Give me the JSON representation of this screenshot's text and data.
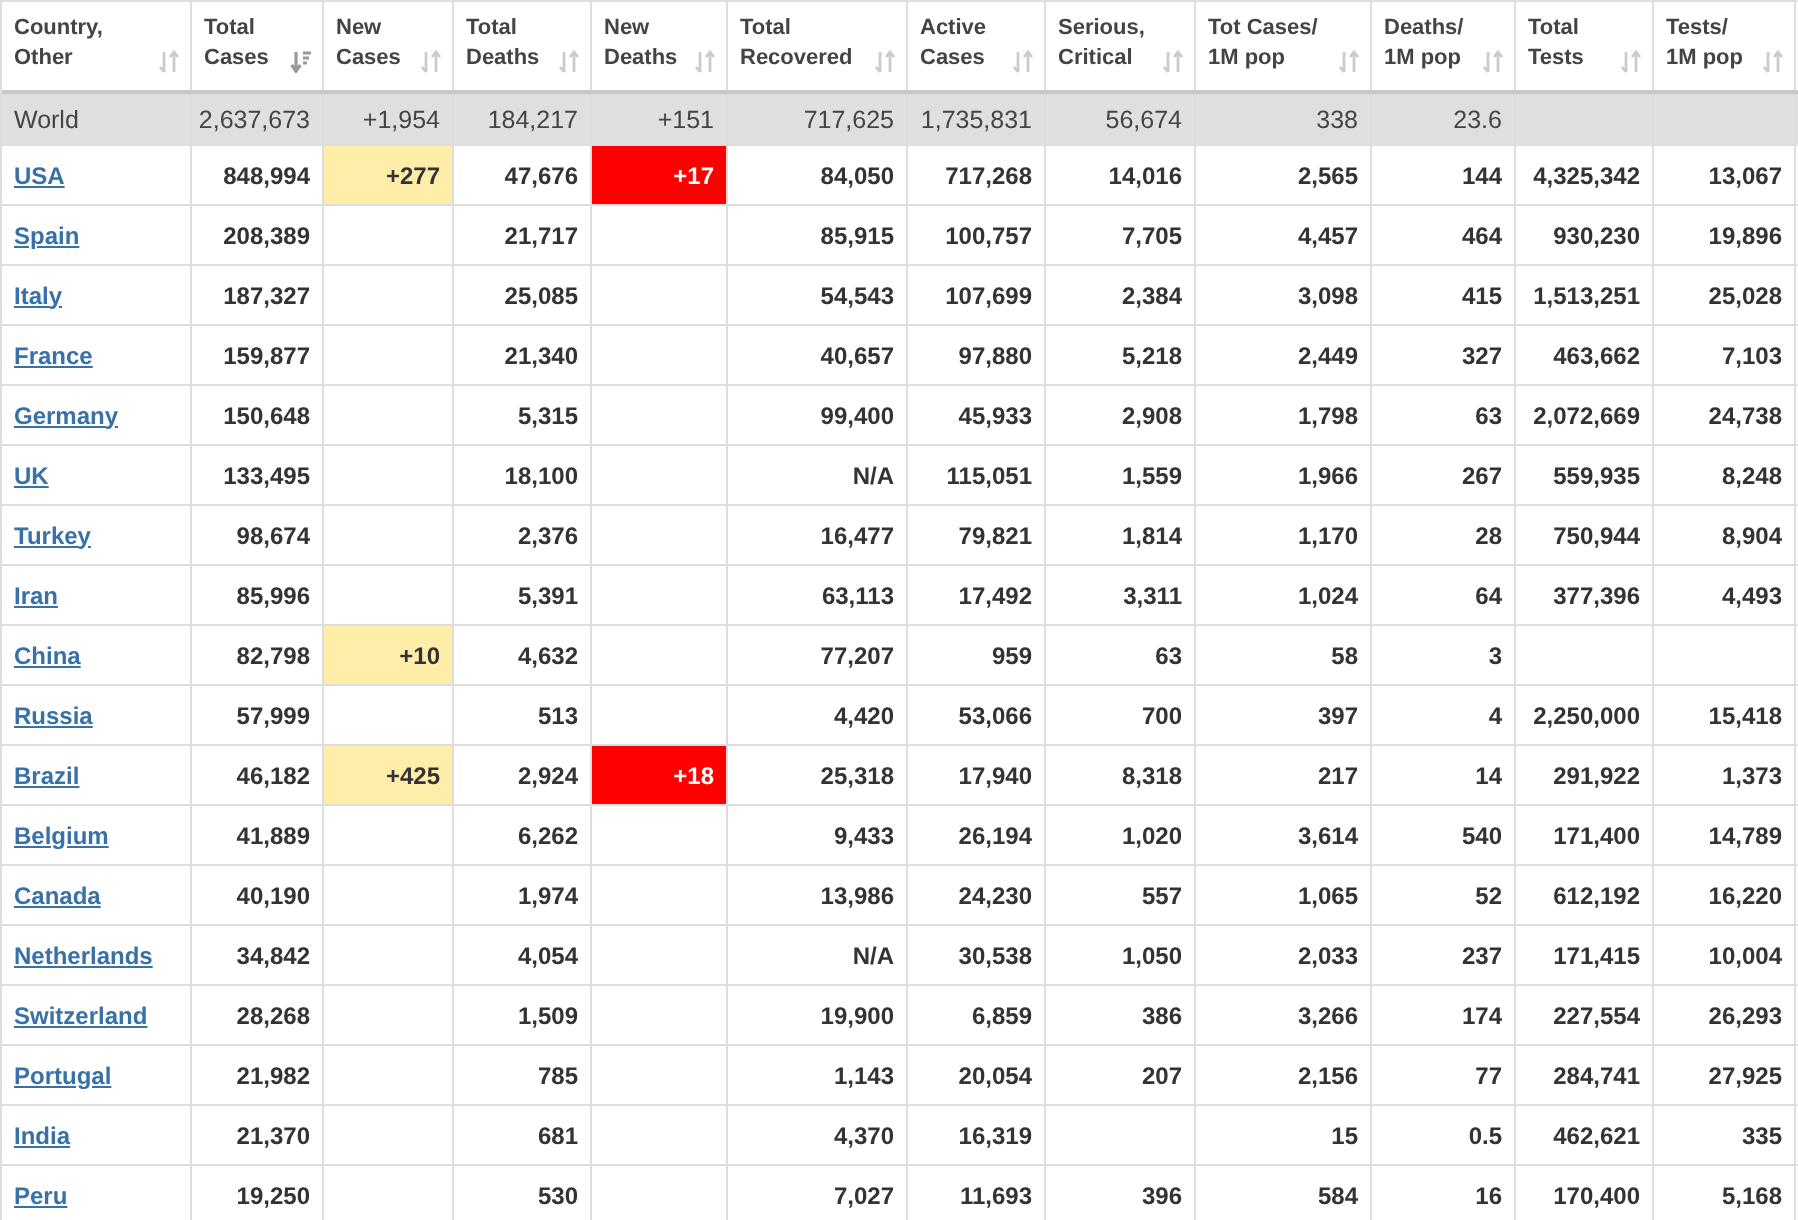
{
  "table": {
    "columns": [
      {
        "label_lines": [
          "Country,",
          "Other"
        ],
        "sorted": false
      },
      {
        "label_lines": [
          "Total",
          "Cases"
        ],
        "sorted": true
      },
      {
        "label_lines": [
          "New",
          "Cases"
        ],
        "sorted": false
      },
      {
        "label_lines": [
          "Total",
          "Deaths"
        ],
        "sorted": false
      },
      {
        "label_lines": [
          "New",
          "Deaths"
        ],
        "sorted": false
      },
      {
        "label_lines": [
          "Total",
          "Recovered"
        ],
        "sorted": false
      },
      {
        "label_lines": [
          "Active",
          "Cases"
        ],
        "sorted": false
      },
      {
        "label_lines": [
          "Serious,",
          "Critical"
        ],
        "sorted": false
      },
      {
        "label_lines": [
          "Tot Cases/",
          "1M pop"
        ],
        "sorted": false
      },
      {
        "label_lines": [
          "Deaths/",
          "1M pop"
        ],
        "sorted": false
      },
      {
        "label_lines": [
          "Total",
          "Tests"
        ],
        "sorted": false
      },
      {
        "label_lines": [
          "Tests/",
          "1M pop"
        ],
        "sorted": false
      }
    ],
    "rows": [
      {
        "kind": "total",
        "country": "World",
        "total_cases": "2,637,673",
        "new_cases": "+1,954",
        "total_deaths": "184,217",
        "new_deaths": "+151",
        "total_recovered": "717,625",
        "active_cases": "1,735,831",
        "serious_critical": "56,674",
        "tot_cases_per_1m": "338",
        "deaths_per_1m": "23.6",
        "new_cases_highlighted": false,
        "new_deaths_highlighted": false
      },
      {
        "kind": "country",
        "country": "USA",
        "total_cases": "848,994",
        "new_cases": "+277",
        "total_deaths": "47,676",
        "new_deaths": "+17",
        "total_recovered": "84,050",
        "active_cases": "717,268",
        "serious_critical": "14,016",
        "tot_cases_per_1m": "2,565",
        "deaths_per_1m": "144",
        "total_tests": "4,325,342",
        "tests_per_1m": "13,067",
        "new_cases_highlighted": true,
        "new_deaths_highlighted": true
      },
      {
        "kind": "country",
        "country": "Spain",
        "total_cases": "208,389",
        "total_deaths": "21,717",
        "total_recovered": "85,915",
        "active_cases": "100,757",
        "serious_critical": "7,705",
        "tot_cases_per_1m": "4,457",
        "deaths_per_1m": "464",
        "total_tests": "930,230",
        "tests_per_1m": "19,896",
        "new_cases_highlighted": false,
        "new_deaths_highlighted": false
      },
      {
        "kind": "country",
        "country": "Italy",
        "total_cases": "187,327",
        "total_deaths": "25,085",
        "total_recovered": "54,543",
        "active_cases": "107,699",
        "serious_critical": "2,384",
        "tot_cases_per_1m": "3,098",
        "deaths_per_1m": "415",
        "total_tests": "1,513,251",
        "tests_per_1m": "25,028",
        "new_cases_highlighted": false,
        "new_deaths_highlighted": false
      },
      {
        "kind": "country",
        "country": "France",
        "total_cases": "159,877",
        "total_deaths": "21,340",
        "total_recovered": "40,657",
        "active_cases": "97,880",
        "serious_critical": "5,218",
        "tot_cases_per_1m": "2,449",
        "deaths_per_1m": "327",
        "total_tests": "463,662",
        "tests_per_1m": "7,103",
        "new_cases_highlighted": false,
        "new_deaths_highlighted": false
      },
      {
        "kind": "country",
        "country": "Germany",
        "total_cases": "150,648",
        "total_deaths": "5,315",
        "total_recovered": "99,400",
        "active_cases": "45,933",
        "serious_critical": "2,908",
        "tot_cases_per_1m": "1,798",
        "deaths_per_1m": "63",
        "total_tests": "2,072,669",
        "tests_per_1m": "24,738",
        "new_cases_highlighted": false,
        "new_deaths_highlighted": false
      },
      {
        "kind": "country",
        "country": "UK",
        "total_cases": "133,495",
        "total_deaths": "18,100",
        "total_recovered": "N/A",
        "active_cases": "115,051",
        "serious_critical": "1,559",
        "tot_cases_per_1m": "1,966",
        "deaths_per_1m": "267",
        "total_tests": "559,935",
        "tests_per_1m": "8,248",
        "new_cases_highlighted": false,
        "new_deaths_highlighted": false
      },
      {
        "kind": "country",
        "country": "Turkey",
        "total_cases": "98,674",
        "total_deaths": "2,376",
        "total_recovered": "16,477",
        "active_cases": "79,821",
        "serious_critical": "1,814",
        "tot_cases_per_1m": "1,170",
        "deaths_per_1m": "28",
        "total_tests": "750,944",
        "tests_per_1m": "8,904",
        "new_cases_highlighted": false,
        "new_deaths_highlighted": false
      },
      {
        "kind": "country",
        "country": "Iran",
        "total_cases": "85,996",
        "total_deaths": "5,391",
        "total_recovered": "63,113",
        "active_cases": "17,492",
        "serious_critical": "3,311",
        "tot_cases_per_1m": "1,024",
        "deaths_per_1m": "64",
        "total_tests": "377,396",
        "tests_per_1m": "4,493",
        "new_cases_highlighted": false,
        "new_deaths_highlighted": false
      },
      {
        "kind": "country",
        "country": "China",
        "total_cases": "82,798",
        "new_cases": "+10",
        "total_deaths": "4,632",
        "total_recovered": "77,207",
        "active_cases": "959",
        "serious_critical": "63",
        "tot_cases_per_1m": "58",
        "deaths_per_1m": "3",
        "new_cases_highlighted": true,
        "new_deaths_highlighted": false
      },
      {
        "kind": "country",
        "country": "Russia",
        "total_cases": "57,999",
        "total_deaths": "513",
        "total_recovered": "4,420",
        "active_cases": "53,066",
        "serious_critical": "700",
        "tot_cases_per_1m": "397",
        "deaths_per_1m": "4",
        "total_tests": "2,250,000",
        "tests_per_1m": "15,418",
        "new_cases_highlighted": false,
        "new_deaths_highlighted": false
      },
      {
        "kind": "country",
        "country": "Brazil",
        "total_cases": "46,182",
        "new_cases": "+425",
        "total_deaths": "2,924",
        "new_deaths": "+18",
        "total_recovered": "25,318",
        "active_cases": "17,940",
        "serious_critical": "8,318",
        "tot_cases_per_1m": "217",
        "deaths_per_1m": "14",
        "total_tests": "291,922",
        "tests_per_1m": "1,373",
        "new_cases_highlighted": true,
        "new_deaths_highlighted": true
      },
      {
        "kind": "country",
        "country": "Belgium",
        "total_cases": "41,889",
        "total_deaths": "6,262",
        "total_recovered": "9,433",
        "active_cases": "26,194",
        "serious_critical": "1,020",
        "tot_cases_per_1m": "3,614",
        "deaths_per_1m": "540",
        "total_tests": "171,400",
        "tests_per_1m": "14,789",
        "new_cases_highlighted": false,
        "new_deaths_highlighted": false
      },
      {
        "kind": "country",
        "country": "Canada",
        "total_cases": "40,190",
        "total_deaths": "1,974",
        "total_recovered": "13,986",
        "active_cases": "24,230",
        "serious_critical": "557",
        "tot_cases_per_1m": "1,065",
        "deaths_per_1m": "52",
        "total_tests": "612,192",
        "tests_per_1m": "16,220",
        "new_cases_highlighted": false,
        "new_deaths_highlighted": false
      },
      {
        "kind": "country",
        "country": "Netherlands",
        "total_cases": "34,842",
        "total_deaths": "4,054",
        "total_recovered": "N/A",
        "active_cases": "30,538",
        "serious_critical": "1,050",
        "tot_cases_per_1m": "2,033",
        "deaths_per_1m": "237",
        "total_tests": "171,415",
        "tests_per_1m": "10,004",
        "new_cases_highlighted": false,
        "new_deaths_highlighted": false
      },
      {
        "kind": "country",
        "country": "Switzerland",
        "total_cases": "28,268",
        "total_deaths": "1,509",
        "total_recovered": "19,900",
        "active_cases": "6,859",
        "serious_critical": "386",
        "tot_cases_per_1m": "3,266",
        "deaths_per_1m": "174",
        "total_tests": "227,554",
        "tests_per_1m": "26,293",
        "new_cases_highlighted": false,
        "new_deaths_highlighted": false
      },
      {
        "kind": "country",
        "country": "Portugal",
        "total_cases": "21,982",
        "total_deaths": "785",
        "total_recovered": "1,143",
        "active_cases": "20,054",
        "serious_critical": "207",
        "tot_cases_per_1m": "2,156",
        "deaths_per_1m": "77",
        "total_tests": "284,741",
        "tests_per_1m": "27,925",
        "new_cases_highlighted": false,
        "new_deaths_highlighted": false
      },
      {
        "kind": "country",
        "country": "India",
        "total_cases": "21,370",
        "total_deaths": "681",
        "total_recovered": "4,370",
        "active_cases": "16,319",
        "tot_cases_per_1m": "15",
        "deaths_per_1m": "0.5",
        "total_tests": "462,621",
        "tests_per_1m": "335",
        "new_cases_highlighted": false,
        "new_deaths_highlighted": false
      },
      {
        "kind": "country",
        "country": "Peru",
        "total_cases": "19,250",
        "total_deaths": "530",
        "total_recovered": "7,027",
        "active_cases": "11,693",
        "serious_critical": "396",
        "tot_cases_per_1m": "584",
        "deaths_per_1m": "16",
        "total_tests": "170,400",
        "tests_per_1m": "5,168",
        "new_cases_highlighted": false,
        "new_deaths_highlighted": false
      }
    ]
  }
}
